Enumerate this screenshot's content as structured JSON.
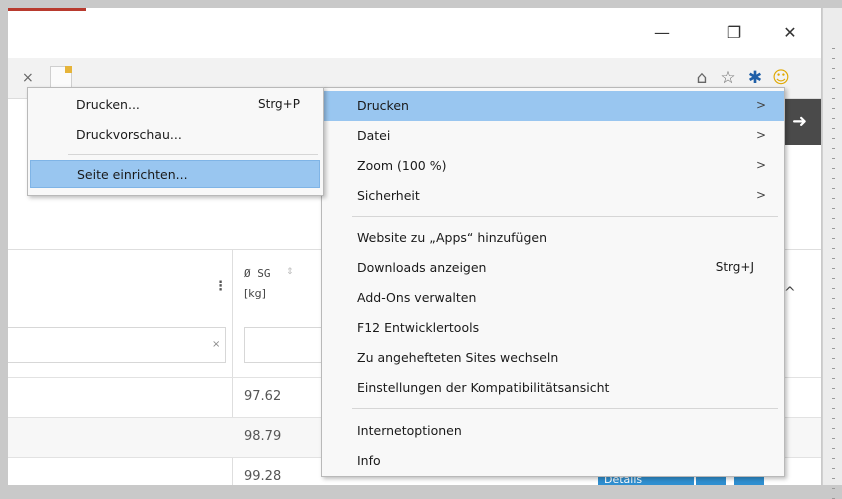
{
  "window": {
    "minimize_glyph": "—",
    "restore_glyph": "❐",
    "close_glyph": "✕"
  },
  "toolbar": {
    "tab_close_glyph": "×",
    "home_icon": "⌂",
    "favorites_icon": "☆",
    "tools_icon": "✱",
    "feedback_icon": "☺"
  },
  "page": {
    "nav_arrow_glyph": "➜",
    "column_header_line1": "Ø SG",
    "column_header_line2": "[kg]",
    "kebab_glyph": "⋮",
    "sort_glyph": "⇕",
    "filter_clear_glyph": "×",
    "collapse_glyph": "^",
    "rows": [
      {
        "sg": "97.62"
      },
      {
        "sg": "98.79"
      },
      {
        "sg": "99.28"
      }
    ],
    "details_label": "Details"
  },
  "main_menu": {
    "items": [
      {
        "label": "Drucken",
        "arrow": ">",
        "shortcut": ""
      },
      {
        "label": "Datei",
        "arrow": ">",
        "shortcut": ""
      },
      {
        "label": "Zoom (100 %)",
        "arrow": ">",
        "shortcut": ""
      },
      {
        "label": "Sicherheit",
        "arrow": ">",
        "shortcut": ""
      },
      {
        "label": "Website zu „Apps“ hinzufügen",
        "arrow": "",
        "shortcut": ""
      },
      {
        "label": "Downloads anzeigen",
        "arrow": "",
        "shortcut": "Strg+J"
      },
      {
        "label": "Add-Ons verwalten",
        "arrow": "",
        "shortcut": ""
      },
      {
        "label": "F12 Entwicklertools",
        "arrow": "",
        "shortcut": ""
      },
      {
        "label": "Zu angehefteten Sites wechseln",
        "arrow": "",
        "shortcut": ""
      },
      {
        "label": "Einstellungen der Kompatibilitätsansicht",
        "arrow": "",
        "shortcut": ""
      },
      {
        "label": "Internetoptionen",
        "arrow": "",
        "shortcut": ""
      },
      {
        "label": "Info",
        "arrow": "",
        "shortcut": ""
      }
    ]
  },
  "sub_menu": {
    "items": [
      {
        "label": "Drucken...",
        "shortcut": "Strg+P"
      },
      {
        "label": "Druckvorschau...",
        "shortcut": ""
      },
      {
        "label": "Seite einrichten...",
        "shortcut": ""
      }
    ]
  },
  "colors": {
    "highlight": "#99c6f0",
    "menu_bg": "#f8f8f8",
    "accent_blue": "#2f8fd0"
  }
}
